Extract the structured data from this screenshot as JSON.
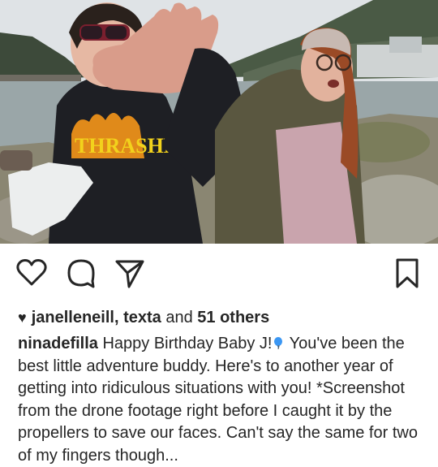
{
  "post": {
    "likes": {
      "users": "janelleneill, texta",
      "connector": "and",
      "count": "51 others"
    },
    "caption": {
      "username": "ninadefilla",
      "text_before_emoji": "Happy Birthday Baby J!",
      "emoji": "balloon-emoji",
      "text_after_emoji": "You've been the best little adventure buddy. Here's to another year of getting into ridiculous situations with you! *Screenshot from the drone footage right before I caught it by the propellers to save our faces. Can't say the same for two of my fingers though..."
    },
    "photo": {
      "hoodie_text": "THRASHER"
    }
  },
  "icons": {
    "like": "heart-outline-icon",
    "comment": "comment-bubble-icon",
    "share": "paper-plane-icon",
    "save": "bookmark-icon",
    "likes_heart": "heart-filled-icon"
  },
  "colors": {
    "text": "#262626",
    "balloon": "#3b97f3"
  }
}
